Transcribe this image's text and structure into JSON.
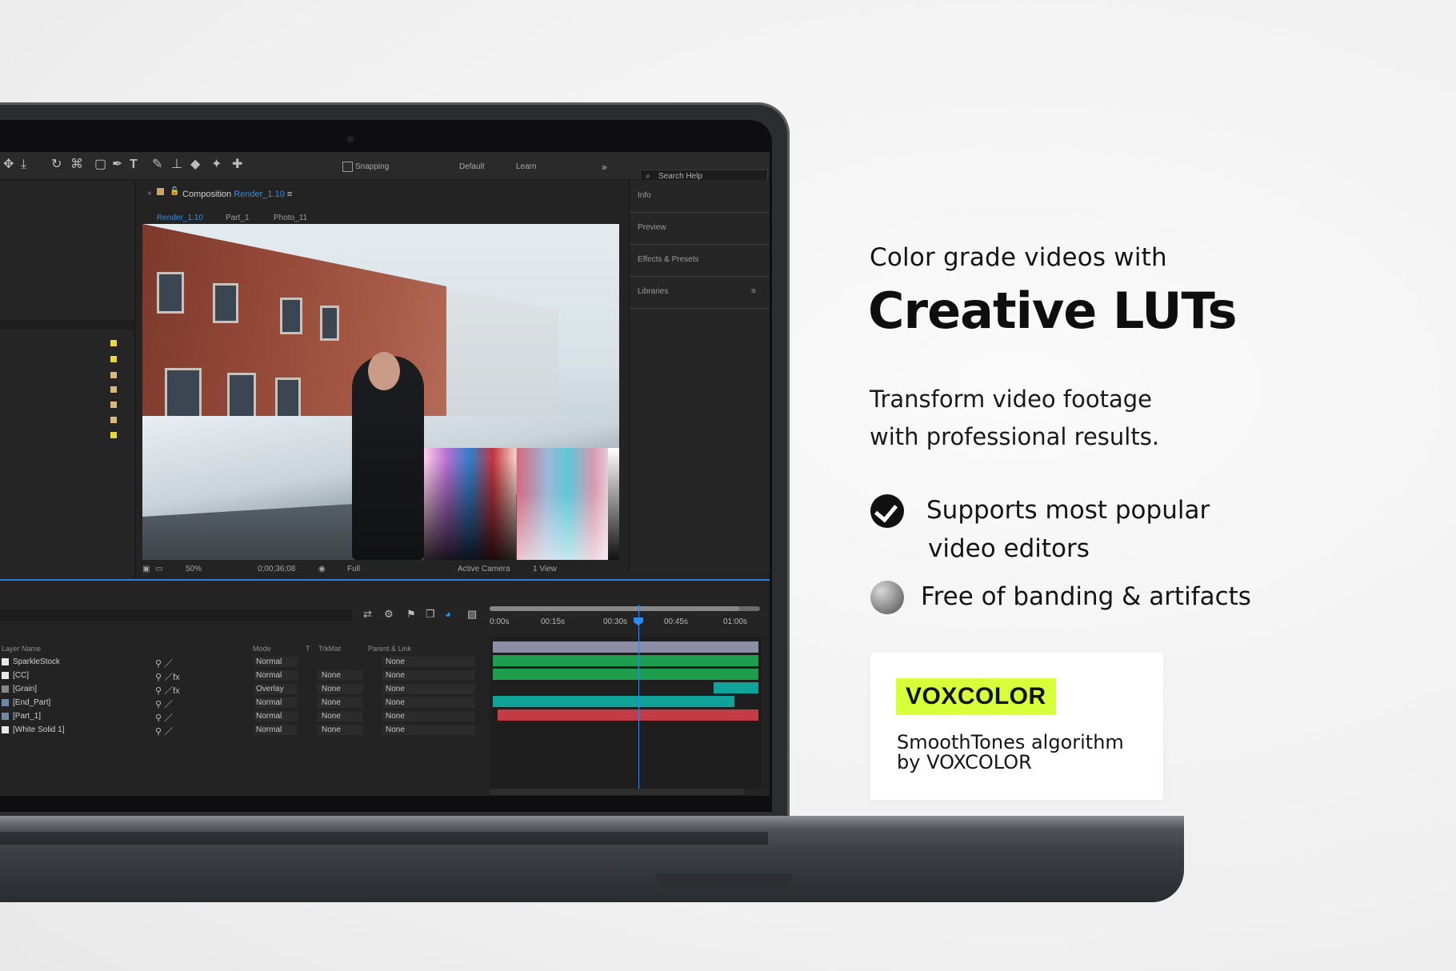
{
  "toolbar": {
    "snapping": "Snapping",
    "workspace_default": "Default",
    "workspace_learn": "Learn",
    "search_help": "Search Help"
  },
  "composition": {
    "label": "Composition",
    "name": "Render_1.10",
    "tabs": [
      "Render_1.10",
      "Part_1",
      "Photo_11"
    ]
  },
  "viewer_footer": {
    "zoom": "50%",
    "timecode": "0;00;36;08",
    "resolution": "Full",
    "camera": "Active Camera",
    "views": "1 View"
  },
  "right_panel": [
    "Info",
    "Preview",
    "Effects & Presets",
    "Libraries"
  ],
  "timeline": {
    "ruler": [
      "0:00s",
      "00:15s",
      "00:30s",
      "00:45s",
      "01:00s"
    ],
    "columns": {
      "layer_name": "Layer Name",
      "mode": "Mode",
      "t": "T",
      "trkmat": "TrkMat",
      "parent": "Parent & Link"
    },
    "layers": [
      {
        "name": "SparkleStock",
        "mode": "Normal",
        "trkmat": "",
        "parent": "None"
      },
      {
        "name": "[CC]",
        "mode": "Normal",
        "trkmat": "None",
        "parent": "None"
      },
      {
        "name": "[Grain]",
        "mode": "Overlay",
        "trkmat": "None",
        "parent": "None"
      },
      {
        "name": "[End_Part]",
        "mode": "Normal",
        "trkmat": "None",
        "parent": "None"
      },
      {
        "name": "[Part_1]",
        "mode": "Normal",
        "trkmat": "None",
        "parent": "None"
      },
      {
        "name": "[White Solid 1]",
        "mode": "Normal",
        "trkmat": "None",
        "parent": "None"
      }
    ]
  },
  "marketing": {
    "kicker": "Color grade videos with",
    "headline": "Creative LUTs",
    "sub_line1": "Transform video footage",
    "sub_line2": "with professional results.",
    "feature1_line1": "Supports most popular",
    "feature1_line2": "video editors",
    "feature2": "Free of banding & artifacts",
    "brand": "VOXCOLOR",
    "algo_line1": "SmoothTones algorithm",
    "algo_line2": "by VOXCOLOR"
  },
  "colors": {
    "accent_blue": "#2d8ceb",
    "brand_lime": "#d8ff3a",
    "track_green": "#1f9d4f",
    "track_teal": "#11a39a",
    "track_red": "#c23b45",
    "track_gray": "#8d8da5"
  }
}
